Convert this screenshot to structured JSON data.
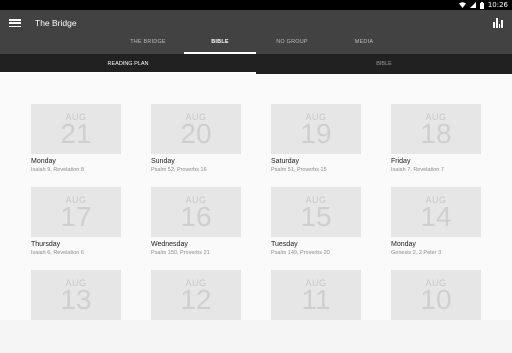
{
  "status": {
    "time": "10:26",
    "wifi_icon": "wifi-icon",
    "signal_icon": "signal-icon",
    "battery_icon": "battery-icon"
  },
  "app_bar": {
    "title": "The Bridge",
    "menu_icon": "menu-icon",
    "action_icon": "bar-chart-icon"
  },
  "tabs": [
    {
      "label": "THE BRIDGE",
      "active": false
    },
    {
      "label": "BIBLE",
      "active": true
    },
    {
      "label": "NO GROUP",
      "active": false
    },
    {
      "label": "MEDIA",
      "active": false
    }
  ],
  "sub_tabs": [
    {
      "label": "READING PLAN",
      "active": true
    },
    {
      "label": "BIBLE",
      "active": false
    }
  ],
  "readings": [
    {
      "month": "AUG",
      "day": "21",
      "weekday": "Monday",
      "passage": "Isaiah 9, Revelation 8"
    },
    {
      "month": "AUG",
      "day": "20",
      "weekday": "Sunday",
      "passage": "Psalm 52, Proverbs 16"
    },
    {
      "month": "AUG",
      "day": "19",
      "weekday": "Saturday",
      "passage": "Psalm 51, Proverbs 15"
    },
    {
      "month": "AUG",
      "day": "18",
      "weekday": "Friday",
      "passage": "Isaiah 7, Revelation 7"
    },
    {
      "month": "AUG",
      "day": "17",
      "weekday": "Thursday",
      "passage": "Isaiah 6, Revelation 6"
    },
    {
      "month": "AUG",
      "day": "16",
      "weekday": "Wednesday",
      "passage": "Psalm 150, Proverbs 21"
    },
    {
      "month": "AUG",
      "day": "15",
      "weekday": "Tuesday",
      "passage": "Psalm 149, Proverbs 20"
    },
    {
      "month": "AUG",
      "day": "14",
      "weekday": "Monday",
      "passage": "Genesis 2, 2 Peter 3"
    },
    {
      "month": "AUG",
      "day": "13",
      "weekday": "",
      "passage": ""
    },
    {
      "month": "AUG",
      "day": "12",
      "weekday": "",
      "passage": ""
    },
    {
      "month": "AUG",
      "day": "11",
      "weekday": "",
      "passage": ""
    },
    {
      "month": "AUG",
      "day": "10",
      "weekday": "",
      "passage": ""
    }
  ]
}
